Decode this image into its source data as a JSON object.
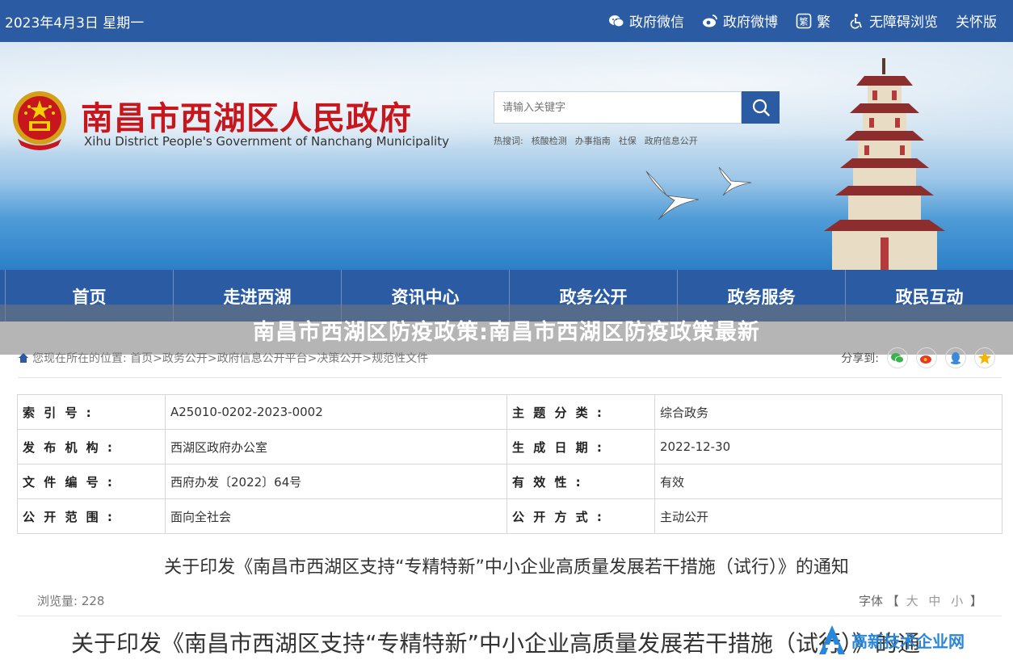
{
  "topbar": {
    "date": "2023年4月3日 星期一",
    "links": [
      {
        "label": "政府微信",
        "icon": "wechat-icon"
      },
      {
        "label": "政府微博",
        "icon": "weibo-icon"
      },
      {
        "label": "繁",
        "icon": "traditional-chinese-icon"
      },
      {
        "label": "无障碍浏览",
        "icon": "accessibility-icon"
      },
      {
        "label": "关怀版",
        "icon": ""
      }
    ]
  },
  "banner": {
    "title": "南昌市西湖区人民政府",
    "subtitle": "Xihu District People's Government of Nanchang Municipality",
    "search_placeholder": "请输入关键字",
    "hot_label": "热搜词:",
    "hot_words": [
      "核酸检测",
      "办事指南",
      "社保",
      "政府信息公开"
    ]
  },
  "nav": [
    "首页",
    "走进西湖",
    "资讯中心",
    "政务公开",
    "政务服务",
    "政民互动"
  ],
  "overlay_title": "南昌市西湖区防疫政策:南昌市西湖区防疫政策最新",
  "breadcrumb": {
    "text": "您现在所在的位置: 首页>政务公开>政府信息公开平台>决策公开>规范性文件",
    "share_label": "分享到:"
  },
  "info_table": [
    [
      "索 引 号 :",
      "A25010-0202-2023-0002",
      "主 题 分 类 :",
      "综合政务"
    ],
    [
      "发 布 机 构 :",
      "西湖区政府办公室",
      "生 成 日 期 :",
      "2022-12-30"
    ],
    [
      "文 件 编 号 :",
      "西府办发〔2022〕64号",
      "有 效 性 :",
      "有效"
    ],
    [
      "公 开 范 围 :",
      "面向全社会",
      "公 开 方 式 :",
      "主动公开"
    ]
  ],
  "doc": {
    "title": "关于印发《南昌市西湖区支持“专精特新”中小企业高质量发展若干措施（试行）》的通知",
    "views_label": "浏览量:",
    "views": "228",
    "font_label": "字体",
    "font_open": "【",
    "font_options": [
      "大",
      "中",
      "小"
    ],
    "font_close": "】",
    "big_title": "关于印发《南昌市西湖区支持“专精特新”中小企业高质量发展若干措施（试行）》的通"
  },
  "watermark": {
    "text": "高新技术企业网"
  },
  "colors": {
    "brand_blue": "#2b5ba3",
    "title_red": "#c8161d"
  }
}
